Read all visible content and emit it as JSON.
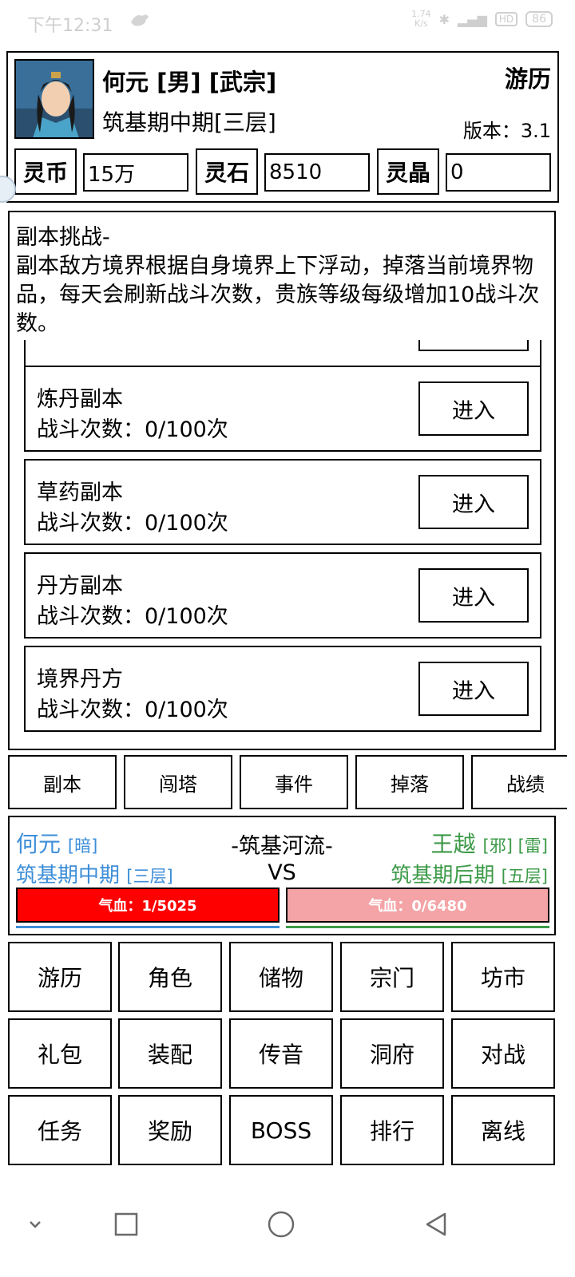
{
  "status_bar": {
    "time": "下午12:31",
    "speed_top": "1.74",
    "speed_bottom": "K/s",
    "hd": "HD",
    "battery": "86"
  },
  "header": {
    "name": "何元 [男] [武宗]",
    "realm": "筑基期中期[三层]",
    "travel": "游历",
    "version": "版本：3.1",
    "currencies": [
      {
        "label": "灵币",
        "value": "15万"
      },
      {
        "label": "灵石",
        "value": "8510"
      },
      {
        "label": "灵晶",
        "value": "0"
      }
    ]
  },
  "panel": {
    "title": "副本挑战-",
    "description": "副本敌方境界根据自身境界上下浮动，掉落当前境界物品，每天会刷新战斗次数，贵族等级每级增加10战斗次数。",
    "dungeons": [
      {
        "name": "炼丹副本",
        "count": "战斗次数：0/100次",
        "button": "进入"
      },
      {
        "name": "草药副本",
        "count": "战斗次数：0/100次",
        "button": "进入"
      },
      {
        "name": "丹方副本",
        "count": "战斗次数：0/100次",
        "button": "进入"
      },
      {
        "name": "境界丹方",
        "count": "战斗次数：0/100次",
        "button": "进入"
      }
    ]
  },
  "tabs": [
    "副本",
    "闯塔",
    "事件",
    "掉落",
    "战绩"
  ],
  "battle": {
    "player": {
      "name": "何元",
      "tag": "[暗]",
      "realm": "筑基期中期",
      "layer": "[三层]",
      "hp": "气血：1/5025",
      "hp_fraction": 1.0
    },
    "location": "-筑基河流-",
    "vs": "VS",
    "enemy": {
      "name": "王越",
      "tags": "[邪] [雷]",
      "realm": "筑基期后期",
      "layer": "[五层]",
      "hp": "气血：0/6480",
      "hp_fraction": 1.0
    }
  },
  "menu": [
    "游历",
    "角色",
    "储物",
    "宗门",
    "坊市",
    "礼包",
    "装配",
    "传音",
    "洞府",
    "对战",
    "任务",
    "奖励",
    "BOSS",
    "排行",
    "离线"
  ],
  "colors": {
    "player": "#3d8ed8",
    "enemy": "#3c9a48",
    "hp_player": "#ff0000",
    "hp_enemy": "#f4a4a6"
  },
  "nav_icons": [
    "chevron-down-icon",
    "recent-apps-icon",
    "home-icon",
    "back-icon"
  ]
}
